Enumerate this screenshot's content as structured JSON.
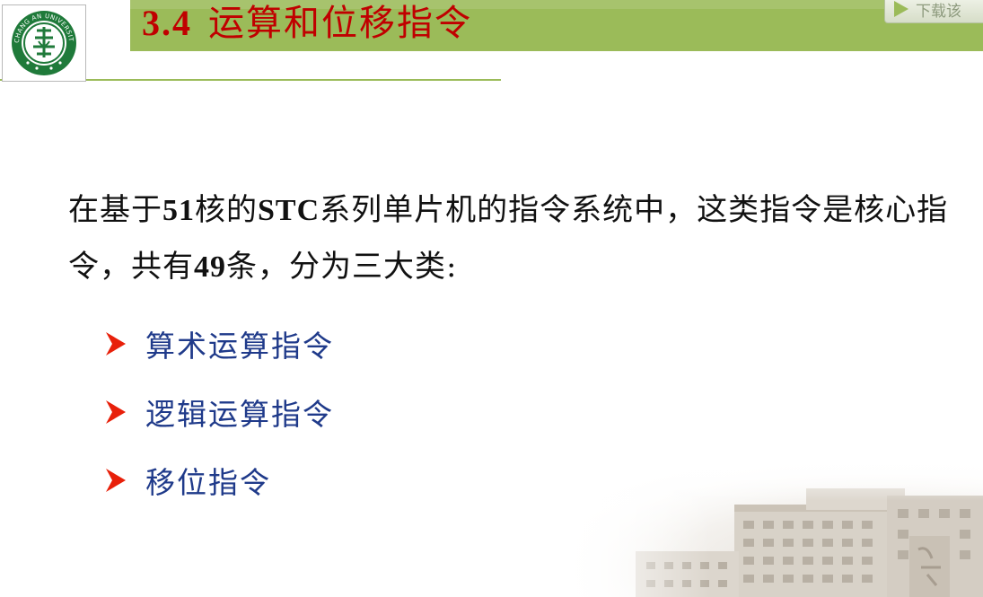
{
  "header": {
    "section_number": "3.4",
    "section_title": "运算和位移指令",
    "download_label": "下载该"
  },
  "logo": {
    "circle_text": "CHANG AN UNIVERSITY",
    "emblem_chars": "长大"
  },
  "content": {
    "intro_parts": [
      "在基于",
      "51",
      "核的",
      "STC",
      "系列单片机的指令系统中，这类指令是核心指令，共有",
      "49",
      "条，分为三大类:"
    ],
    "bullets": [
      {
        "label": "算术运算指令"
      },
      {
        "label": "逻辑运算指令"
      },
      {
        "label": "移位指令"
      }
    ]
  },
  "colors": {
    "header_band": "#9bbb59",
    "title_red": "#c00000",
    "bullet_arrow": "#e8200a",
    "bullet_text": "#1f3a8a"
  }
}
